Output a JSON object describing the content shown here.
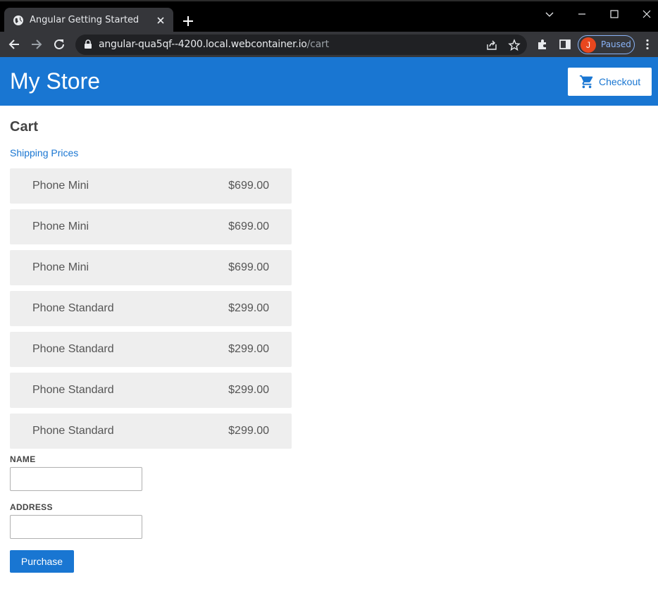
{
  "browser": {
    "tab_title": "Angular Getting Started",
    "url_host": "angular-qua5qf--4200.local.webcontainer.io",
    "url_path": "/cart",
    "profile_initial": "J",
    "profile_status": "Paused",
    "icons": [
      "globe-icon",
      "close-icon",
      "plus-icon",
      "back-icon",
      "forward-icon",
      "reload-icon",
      "lock-icon",
      "share-icon",
      "star-icon",
      "extensions-icon",
      "side-panel-icon",
      "menu-icon"
    ]
  },
  "header": {
    "title": "My Store",
    "checkout_label": "Checkout",
    "accent": "#1976d2"
  },
  "cart": {
    "title": "Cart",
    "shipping_link": "Shipping Prices",
    "items": [
      {
        "name": "Phone Mini",
        "price": "$699.00"
      },
      {
        "name": "Phone Mini",
        "price": "$699.00"
      },
      {
        "name": "Phone Mini",
        "price": "$699.00"
      },
      {
        "name": "Phone Standard",
        "price": "$299.00"
      },
      {
        "name": "Phone Standard",
        "price": "$299.00"
      },
      {
        "name": "Phone Standard",
        "price": "$299.00"
      },
      {
        "name": "Phone Standard",
        "price": "$299.00"
      }
    ]
  },
  "form": {
    "name_label": "NAME",
    "name_value": "",
    "address_label": "ADDRESS",
    "address_value": "",
    "purchase_label": "Purchase"
  }
}
